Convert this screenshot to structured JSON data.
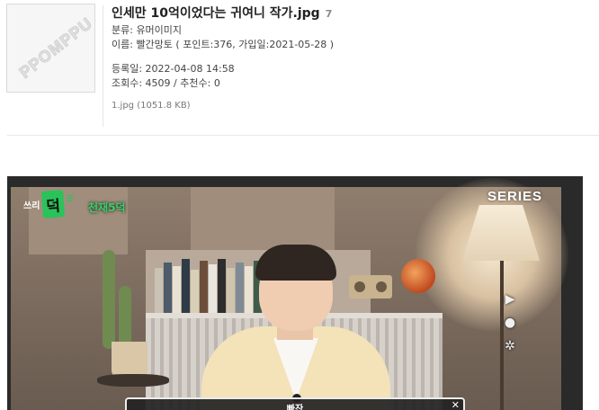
{
  "post": {
    "title": "인세만 10억이었다는 귀여니 작가.jpg",
    "comment_count": "7",
    "category": "분류: 유머이미지",
    "author": "이름: 빨간망토 ( 포인트:376, 가입일:2021-05-28 )",
    "registered": "등록일: 2022-04-08 14:58",
    "stats": "조회수: 4509 / 추천수: 0",
    "attachment": "1.jpg (1051.8 KB)",
    "thumbnail_watermark": "PPOMPPU"
  },
  "video": {
    "logo_prefix": "쓰리",
    "logo_mark": "덕",
    "logo_suffix": "츠",
    "hashtag": "천재5덕",
    "series_label": "SERIES",
    "caption": "빠잔",
    "caption_close": "✕",
    "icons": [
      "video-camera-icon",
      "microphone-icon",
      "gear-icon"
    ]
  },
  "colors": {
    "accent_green": "#29c35a",
    "title_text": "#222222"
  }
}
